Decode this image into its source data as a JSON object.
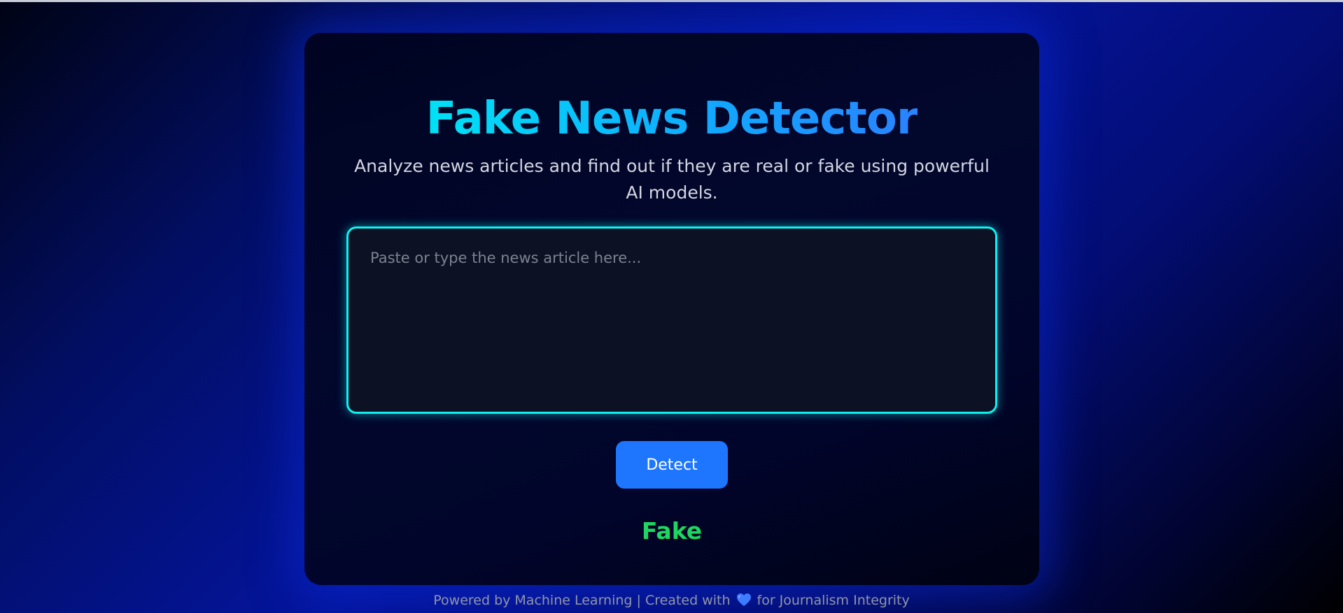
{
  "app": {
    "title": "Fake News Detector",
    "subtitle": "Analyze news articles and find out if they are real or fake using powerful AI models."
  },
  "form": {
    "article_placeholder": "Paste or type the news article here...",
    "article_value": "",
    "detect_label": "Detect"
  },
  "result": {
    "label": "Fake",
    "color": "#1ed760"
  },
  "footer": {
    "text_before": "Powered by Machine Learning | Created with",
    "icon": "heart-icon",
    "text_after": "for Journalism Integrity"
  },
  "colors": {
    "accent_cyan": "#10f0f0",
    "button_blue": "#1e76ff",
    "title_gradient_start": "#00e1f5",
    "title_gradient_end": "#2a82ff",
    "heart": "#3d7bff"
  }
}
